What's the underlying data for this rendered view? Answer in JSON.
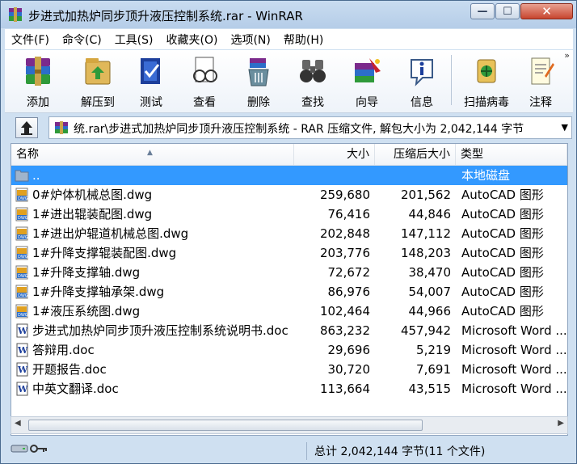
{
  "window": {
    "title": "步进式加热炉同步顶升液压控制系统.rar - WinRAR",
    "min_glyph": "—",
    "max_glyph": "☐",
    "close_glyph": "✕"
  },
  "menu": [
    "文件(F)",
    "命令(C)",
    "工具(S)",
    "收藏夹(O)",
    "选项(N)",
    "帮助(H)"
  ],
  "toolbar": {
    "items": [
      {
        "label": "添加",
        "icon": "add-archive-icon"
      },
      {
        "label": "解压到",
        "icon": "extract-to-icon"
      },
      {
        "label": "测试",
        "icon": "test-icon"
      },
      {
        "label": "查看",
        "icon": "view-icon"
      },
      {
        "label": "删除",
        "icon": "delete-icon"
      },
      {
        "label": "查找",
        "icon": "find-icon"
      },
      {
        "label": "向导",
        "icon": "wizard-icon"
      },
      {
        "label": "信息",
        "icon": "info-icon"
      },
      {
        "label": "扫描病毒",
        "icon": "virus-scan-icon"
      },
      {
        "label": "注释",
        "icon": "comment-icon"
      }
    ],
    "overflow": "»"
  },
  "address": {
    "path": "统.rar\\步进式加热炉同步顶升液压控制系统 - RAR 压缩文件, 解包大小为 2,042,144 字节"
  },
  "columns": {
    "name": "名称",
    "size": "大小",
    "packed": "压缩后大小",
    "type": "类型"
  },
  "files": [
    {
      "name": "..",
      "size": "",
      "packed": "",
      "type": "本地磁盘",
      "icon": "folder-up-icon",
      "selected": true
    },
    {
      "name": "0#炉体机械总图.dwg",
      "size": "259,680",
      "packed": "201,562",
      "type": "AutoCAD 图形",
      "icon": "dwg-file-icon"
    },
    {
      "name": "1#进出辊装配图.dwg",
      "size": "76,416",
      "packed": "44,846",
      "type": "AutoCAD 图形",
      "icon": "dwg-file-icon"
    },
    {
      "name": "1#进出炉辊道机械总图.dwg",
      "size": "202,848",
      "packed": "147,112",
      "type": "AutoCAD 图形",
      "icon": "dwg-file-icon"
    },
    {
      "name": "1#升降支撑辊装配图.dwg",
      "size": "203,776",
      "packed": "148,203",
      "type": "AutoCAD 图形",
      "icon": "dwg-file-icon"
    },
    {
      "name": "1#升降支撑轴.dwg",
      "size": "72,672",
      "packed": "38,470",
      "type": "AutoCAD 图形",
      "icon": "dwg-file-icon"
    },
    {
      "name": "1#升降支撑轴承架.dwg",
      "size": "86,976",
      "packed": "54,007",
      "type": "AutoCAD 图形",
      "icon": "dwg-file-icon"
    },
    {
      "name": "1#液压系统图.dwg",
      "size": "102,464",
      "packed": "44,966",
      "type": "AutoCAD 图形",
      "icon": "dwg-file-icon"
    },
    {
      "name": "步进式加热炉同步顶升液压控制系统说明书.doc",
      "size": "863,232",
      "packed": "457,942",
      "type": "Microsoft Word ...",
      "icon": "word-file-icon"
    },
    {
      "name": "答辩用.doc",
      "size": "29,696",
      "packed": "5,219",
      "type": "Microsoft Word ...",
      "icon": "word-file-icon"
    },
    {
      "name": "开题报告.doc",
      "size": "30,720",
      "packed": "7,691",
      "type": "Microsoft Word ...",
      "icon": "word-file-icon"
    },
    {
      "name": "中英文翻译.doc",
      "size": "113,664",
      "packed": "43,515",
      "type": "Microsoft Word ...",
      "icon": "word-file-icon"
    }
  ],
  "status": {
    "summary": "总计 2,042,144 字节(11 个文件)"
  },
  "colors": {
    "selection": "#3399ff",
    "chrome": "#cfe0f1"
  }
}
